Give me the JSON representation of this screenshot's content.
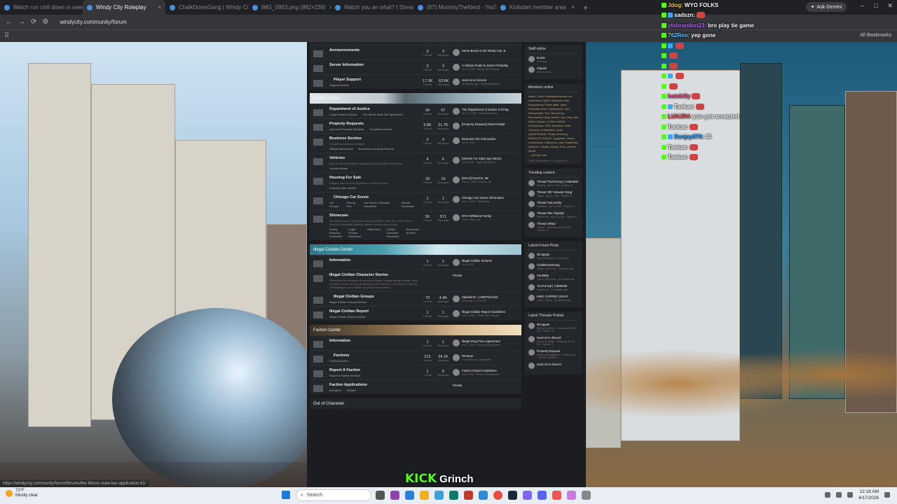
{
  "browser": {
    "tabs": [
      {
        "label": "Watch run chill down in seems t...",
        "active": false
      },
      {
        "label": "Windy City Roleplay",
        "active": true
      },
      {
        "label": "ChalkDownGang | Windy City ...",
        "active": false
      },
      {
        "label": "IMG_0953.png (882×238)",
        "active": false
      },
      {
        "label": "Watch you an what? | Streamer...",
        "active": false
      },
      {
        "label": "(87) MommyTheNerd - YouTub...",
        "active": false
      },
      {
        "label": "Kickstart member area",
        "active": false
      }
    ],
    "new_tab": "+",
    "url": "windycity.community/forum",
    "ask_gemini": "Ask Gemini",
    "all_bookmarks": "All Bookmarks"
  },
  "forum": {
    "categories": [
      {
        "header": "",
        "header_style": "plain",
        "rows": [
          {
            "title": "Announcements",
            "desc": "",
            "sub": [],
            "threads": "3",
            "messages": "3",
            "last_title": "Some-Brock in the Windy City .B",
            "last_meta": "",
            "hot": false
          },
          {
            "title": "Server Information",
            "desc": "",
            "sub": [],
            "threads": "3",
            "messages": "3",
            "last_title": "A Simple Guide to Server Roleplay",
            "last_meta": "Jul 13, 2025 · Windy City Roleplay",
            "hot": false
          },
          {
            "title": "Player Support",
            "desc": "",
            "sub": [
              "Support Archive"
            ],
            "threads": "17.3K",
            "messages": "63.8K",
            "last_title": "need wl on forums",
            "last_meta": "48 minutes ago · Reginaldsignhere",
            "hot": true
          }
        ]
      },
      {
        "header": "Civilian Center",
        "header_style": "img",
        "rows": [
          {
            "title": "Department of Justice",
            "desc": "",
            "sub": [
              "Legal Firearm License",
              "The Illinois State Bar Application"
            ],
            "threads": "34",
            "messages": "67",
            "last_title": "The Department of Justice is hiring.",
            "last_meta": "Nov 17, 2025 · ChalkDownGang",
            "hot": false
          },
          {
            "title": "Property Requests",
            "desc": "",
            "sub": [
              "Approved Property Request",
              "Properties Archive"
            ],
            "threads": "6.8K",
            "messages": "21.7K",
            "last_title": "[Property Request] Rybel Khalaf",
            "last_meta": "",
            "hot": false
          },
          {
            "title": "Business Section",
            "desc": "Everything business related!",
            "sub": [
              "Official Businesses",
              "Business Licensing Request"
            ],
            "threads": "3",
            "messages": "3",
            "last_title": "Business Tier Information",
            "last_meta": "Jun 8, 2025",
            "hot": false
          },
          {
            "title": "Vehicles",
            "desc": "Any and all information regarding vehicles within the server",
            "sub": [
              "Vehicle Market"
            ],
            "threads": "4",
            "messages": "6",
            "last_title": "[Vehicle For Sale] Juju Nacho",
            "last_meta": "Jul 7, 2025 · Taylor/Juju/Nacho",
            "hot": false
          },
          {
            "title": "Housing For Sale",
            "desc": "Players can list their properties to other players!",
            "sub": [
              "Property Sale archive"
            ],
            "threads": "18",
            "messages": "19",
            "last_title": "[SOLD] Rancho, 3B",
            "last_meta": "Sep 22, 2025 · Rancho, 3B",
            "hot": false
          },
          {
            "title": "Chicago Car Scene",
            "desc": "",
            "sub": [
              "Car Groups",
              "Racing Hub",
              "Car Scene Character Showcase",
              "Vehicle Showcase"
            ],
            "threads": "1",
            "messages": "1",
            "last_title": "Chicago Car Scene Information",
            "last_meta": "May 1, 2025 · DBGaming",
            "hot": true
          },
          {
            "title": "Showcase",
            "desc": "Showcase your in character family portraits, clips, etc. to the server. Must be formatted properly, please see the pinned post.",
            "sub": [
              "Family Roleplay Showcase",
              "Legal Groups Showcase",
              "Influencers",
              "Civilian Character Showcase",
              "Showcase Archive"
            ],
            "threads": "56",
            "messages": "571",
            "last_title": "BTAr WilName Family",
            "last_meta": "Feb 6, 2026 · jyd",
            "hot": false
          }
        ]
      },
      {
        "header": "Illegal Civilian Center",
        "header_style": "img2",
        "rows": [
          {
            "title": "Information",
            "desc": "",
            "sub": [],
            "threads": "1",
            "messages": "1",
            "last_title": "Illegal Civilian Scheme",
            "last_meta": "Jul 8, 2025",
            "hot": false
          },
          {
            "title": "Illegal Civilian Character Stories",
            "desc": "Showcase the character from your's illegal roleplay going through, keep up with a thread of your progress as you become a member of a group of Roleplayers at a faction of criminal and infamy.",
            "sub": [],
            "threads": "",
            "messages": "",
            "last_title": "Private",
            "last_meta": "",
            "hot": false
          },
          {
            "title": "Illegal Civilian Groups",
            "desc": "",
            "sub": [
              "Illegal Civilian Groups Archive"
            ],
            "threads": "73",
            "messages": "4.4K",
            "last_title": "Splashmm ::| 900/TDG/Sol",
            "last_meta": "Yesterday at 11:44 PM",
            "hot": true
          },
          {
            "title": "Illegal Civilian Report",
            "desc": "",
            "sub": [
              "Illegal Civilian Report Archive"
            ],
            "threads": "1",
            "messages": "1",
            "last_title": "Illegal Civilian Report Guidelines",
            "last_meta": "Feb 7, 2025 · Windy City Roleplay",
            "hot": false
          }
        ]
      },
      {
        "header": "Faction Center",
        "header_style": "img3",
        "rows": [
          {
            "title": "Information",
            "desc": "",
            "sub": [],
            "threads": "1",
            "messages": "1",
            "last_title": "Illegal Drug Price Agreement",
            "last_meta": "Aug 7, 2025 · Faction Management",
            "hot": false
          },
          {
            "title": "Factions",
            "desc": "",
            "sub": [
              "Faction Archive"
            ],
            "threads": "213",
            "messages": "34.1K",
            "last_title": "WAmper",
            "last_meta": "4 minutes ago · dodgeable",
            "hot": true
          },
          {
            "title": "Report A Faction",
            "desc": "",
            "sub": [
              "Report A Faction Archive"
            ],
            "threads": "1",
            "messages": "0",
            "last_title": "Faction Report Guidelines",
            "last_meta": "Jul 8, 2025 · Faction Management",
            "hot": false
          },
          {
            "title": "Faction Applications",
            "desc": "",
            "sub": [
              "Accepted",
              "Denied"
            ],
            "threads": "",
            "messages": "",
            "last_title": "Private",
            "last_meta": "",
            "hot": false
          }
        ]
      }
    ],
    "footer_header": "Out of Character",
    "labels": {
      "threads": "Threads",
      "messages": "Messages"
    }
  },
  "sidebar": {
    "staff": {
      "title": "Staff online",
      "items": [
        {
          "name": "bcasic",
          "meta": "Developer"
        },
        {
          "name": "Klapski",
          "meta": "Senior Admin"
        }
      ]
    },
    "members": {
      "title": "Members online",
      "text": "abaea, Grinch, bluedayinthewoods, luc, coheerdaim, lollyDi, bluwizzard, Ivan, lollypopfamily, Purple dawn, Kybol, DeathAtBrothers, TopaBear001, Ivan, Mobopmeath, Thor, WackerDoo, MooneyMoy, Dyzzy, Medfer, Joyz, otika, Ahk, Edwin, Klapski, Lol Ball, HotKroll, DonutGordon, OBG, MoneBulk, Yoblk, Ohkachan, KoMacNine, Lucail, QIANDY100000, Pikaka, Echolway, MREZZYSYSTACKK, auggiewfa, Jhtocio, roobiemoose, GalleryLine, Jack, KoldaScrby, Jahzerrs, Turbiblik, Workey, Poco, infoneri, Bartell",
      "more": "... and 186 more.",
      "total": "Total: 263 (members: 174, guests: 27)"
    },
    "trending": {
      "title": "Trending content",
      "items": [
        {
          "name": "Thread 'TooTurnUp | CabMobb'",
          "meta": "Sketchy · Apr 8, 2026 · Replies: 8"
        },
        {
          "name": "Thread '357 Stewart Gang'",
          "meta": "Tilapia · Apr 11, 2026 · Replies: 9"
        },
        {
          "name": "Thread 'NoLuvCity'",
          "meta": "Bibimbap · Apr 9, 2026 · Replies: 11"
        },
        {
          "name": "Thread '801 Flipside'",
          "meta": "BillyTheKid · Apr 13, 2026 · Replies: 6"
        },
        {
          "name": "Thread '3Way'",
          "meta": "Tinwick · Yesterday at 10:33 PM · Replies: 13"
        }
      ]
    },
    "latest_posts": {
      "title": "Latest Forum Posts",
      "items": [
        {
          "name": "5lCappae",
          "meta": "Latest: Boosted · 1 minute ago"
        },
        {
          "name": "ChalkDownGang",
          "meta": "Latest: Toy Brooks · 4 minutes ago"
        },
        {
          "name": "SoulWay",
          "meta": "Latest: Sully Away · 10 minutes ago"
        },
        {
          "name": "TooTurnUp | CabMobb",
          "meta": "Latest: rzzn · 11 minutes ago"
        },
        {
          "name": "KING CAPPER CRAZY",
          "meta": "Latest: Klapski · 22 minutes ago"
        }
      ]
    },
    "latest_threads": {
      "title": "Latest Threads Posted",
      "items": [
        {
          "name": "5lCappae",
          "meta": "Started by Q60K · Yesterday at 10:25 PM · Replies: 28"
        },
        {
          "name": "need wl in discord",
          "meta": "Started by MitgH · Yesterday at 9:47 PM · Replies: 2"
        },
        {
          "name": "Property Request",
          "meta": "Started by maggie825 · Yesterday at 7:56 PM · Replies: 1"
        },
        {
          "name": "need wl on forums",
          "meta": ""
        }
      ]
    }
  },
  "chat": [
    {
      "user": "Jdog:",
      "user_color": "#f5c842",
      "text": "WYO FOLKS",
      "emote": false
    },
    {
      "user": "sadszn:",
      "user_color": "#ffffff",
      "text": "",
      "emote": true
    },
    {
      "user": "ytsbrandon23:",
      "user_color": "#b766ff",
      "text": "bro play tie game",
      "emote": false
    },
    {
      "user": "762Reo:",
      "user_color": "#6ec8ff",
      "text": "yep gone",
      "emote": false
    },
    {
      "user": "",
      "user_color": "#ff4d8a",
      "text": "",
      "emote": true
    },
    {
      "user": "",
      "user_color": "#ff4d8a",
      "text": "",
      "emote": true
    },
    {
      "user": "",
      "user_color": "#ff4d8a",
      "text": "",
      "emote": true
    },
    {
      "user": "",
      "user_color": "#ff4d8a",
      "text": "",
      "emote": true
    },
    {
      "user": "",
      "user_color": "#ff4d8a",
      "text": "",
      "emote": true
    },
    {
      "user": "hatebilly",
      "user_color": "#ff4d8a",
      "text": "",
      "emote": true
    },
    {
      "user": "Taekae:",
      "user_color": "#ffffff",
      "text": "",
      "emote": true
    },
    {
      "user": "LUHJR4:",
      "user_color": "#ff4d4d",
      "text": "you got accepted",
      "emote": false
    },
    {
      "user": "Taekae:",
      "user_color": "#ffffff",
      "text": "",
      "emote": true
    },
    {
      "user": "Danjay876:",
      "user_color": "#2fa8ff",
      "text": "48",
      "emote": false
    },
    {
      "user": "Taekae:",
      "user_color": "#ffffff",
      "text": "",
      "emote": true
    },
    {
      "user": "Taekae:",
      "user_color": "#ffffff",
      "text": "",
      "emote": true
    }
  ],
  "overlay": {
    "kick": "KICK",
    "streamer": "Grinch"
  },
  "status_url": "https://windycity.community/forum/forums/the-illinois-state-bar-application.61/",
  "taskbar": {
    "temp": "73°F",
    "weather": "Mostly clear",
    "search": "Search",
    "time": "12:18 AM",
    "date": "4/17/2026"
  }
}
